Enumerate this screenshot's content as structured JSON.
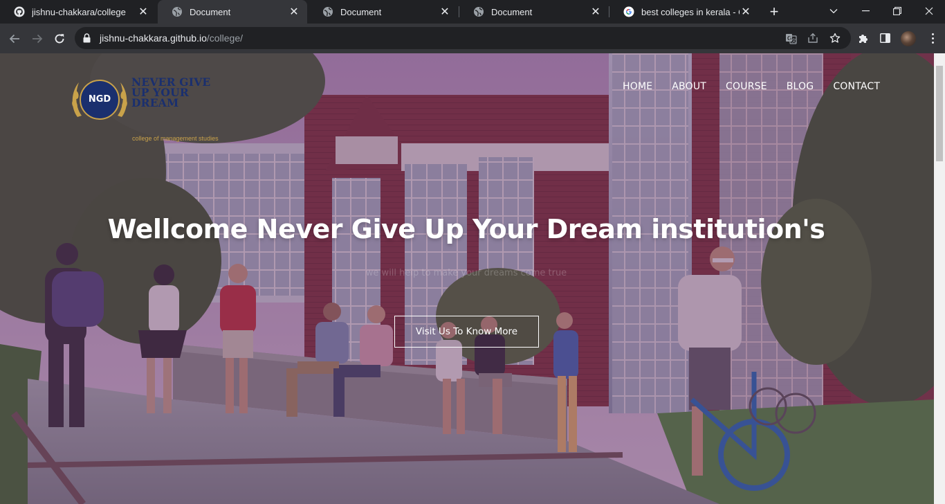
{
  "browser": {
    "tabs": [
      {
        "title": "jishnu-chakkara/college",
        "favicon": "github-icon",
        "active": false
      },
      {
        "title": "Document",
        "favicon": "globe-icon",
        "active": true
      },
      {
        "title": "Document",
        "favicon": "globe-icon",
        "active": false
      },
      {
        "title": "Document",
        "favicon": "globe-icon",
        "active": false
      },
      {
        "title": "best colleges in kerala - Goo",
        "favicon": "google-icon",
        "active": false
      }
    ],
    "url_host": "jishnu-chakkara.github.io",
    "url_path": "/college/"
  },
  "site": {
    "logo": {
      "badge": "NGD",
      "name": "NEVER GIVE UP YOUR DREAM",
      "tagline": "college of management studies"
    },
    "nav": [
      "HOME",
      "ABOUT",
      "COURSE",
      "BLOG",
      "CONTACT"
    ],
    "hero": {
      "title": "Wellcome Never Give Up Your Dream institution's",
      "subtitle": "we will help to make your dreams come true",
      "cta": "Visit Us To Know More"
    }
  },
  "colors": {
    "tab_bar": "#202124",
    "toolbar": "#35363a",
    "overlay": "#5f285f",
    "logo_navy": "#1a2f6e",
    "logo_gold": "#c9a24a"
  }
}
